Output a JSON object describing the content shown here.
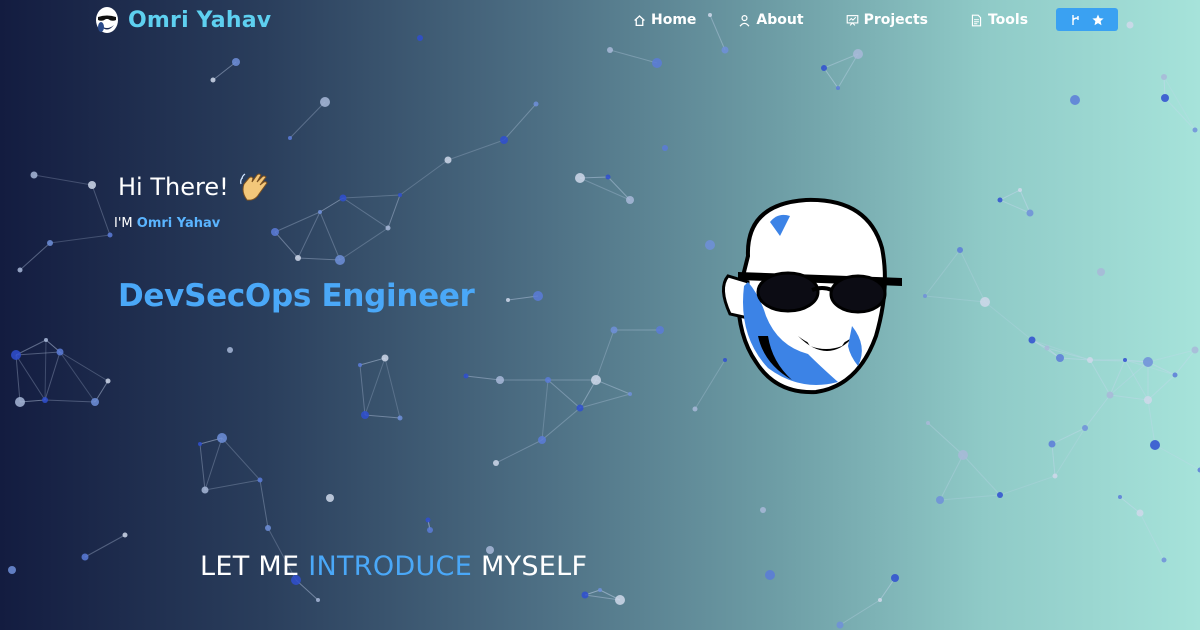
{
  "brand": {
    "name": "Omri Yahav"
  },
  "nav": {
    "home": {
      "label": "Home",
      "icon": "home-icon"
    },
    "about": {
      "label": "About",
      "icon": "user-icon"
    },
    "projects": {
      "label": "Projects",
      "icon": "project-board-icon"
    },
    "tools": {
      "label": "Tools",
      "icon": "document-icon"
    },
    "github": {
      "icons": [
        "git-fork-icon",
        "star-icon"
      ]
    }
  },
  "hero": {
    "greeting": "Hi There!",
    "greeting_icon": "waving-hand-icon",
    "iam_prefix": "I'M",
    "name": "Omri Yahav",
    "role": "DevSecOps Engineer"
  },
  "intro": {
    "part1": "LET ME",
    "highlight": "INTRODUCE",
    "part2": "MYSELF"
  },
  "colors": {
    "accent": "#4aa8f8",
    "brand": "#5ed0f0",
    "button": "#3aa1f2"
  }
}
